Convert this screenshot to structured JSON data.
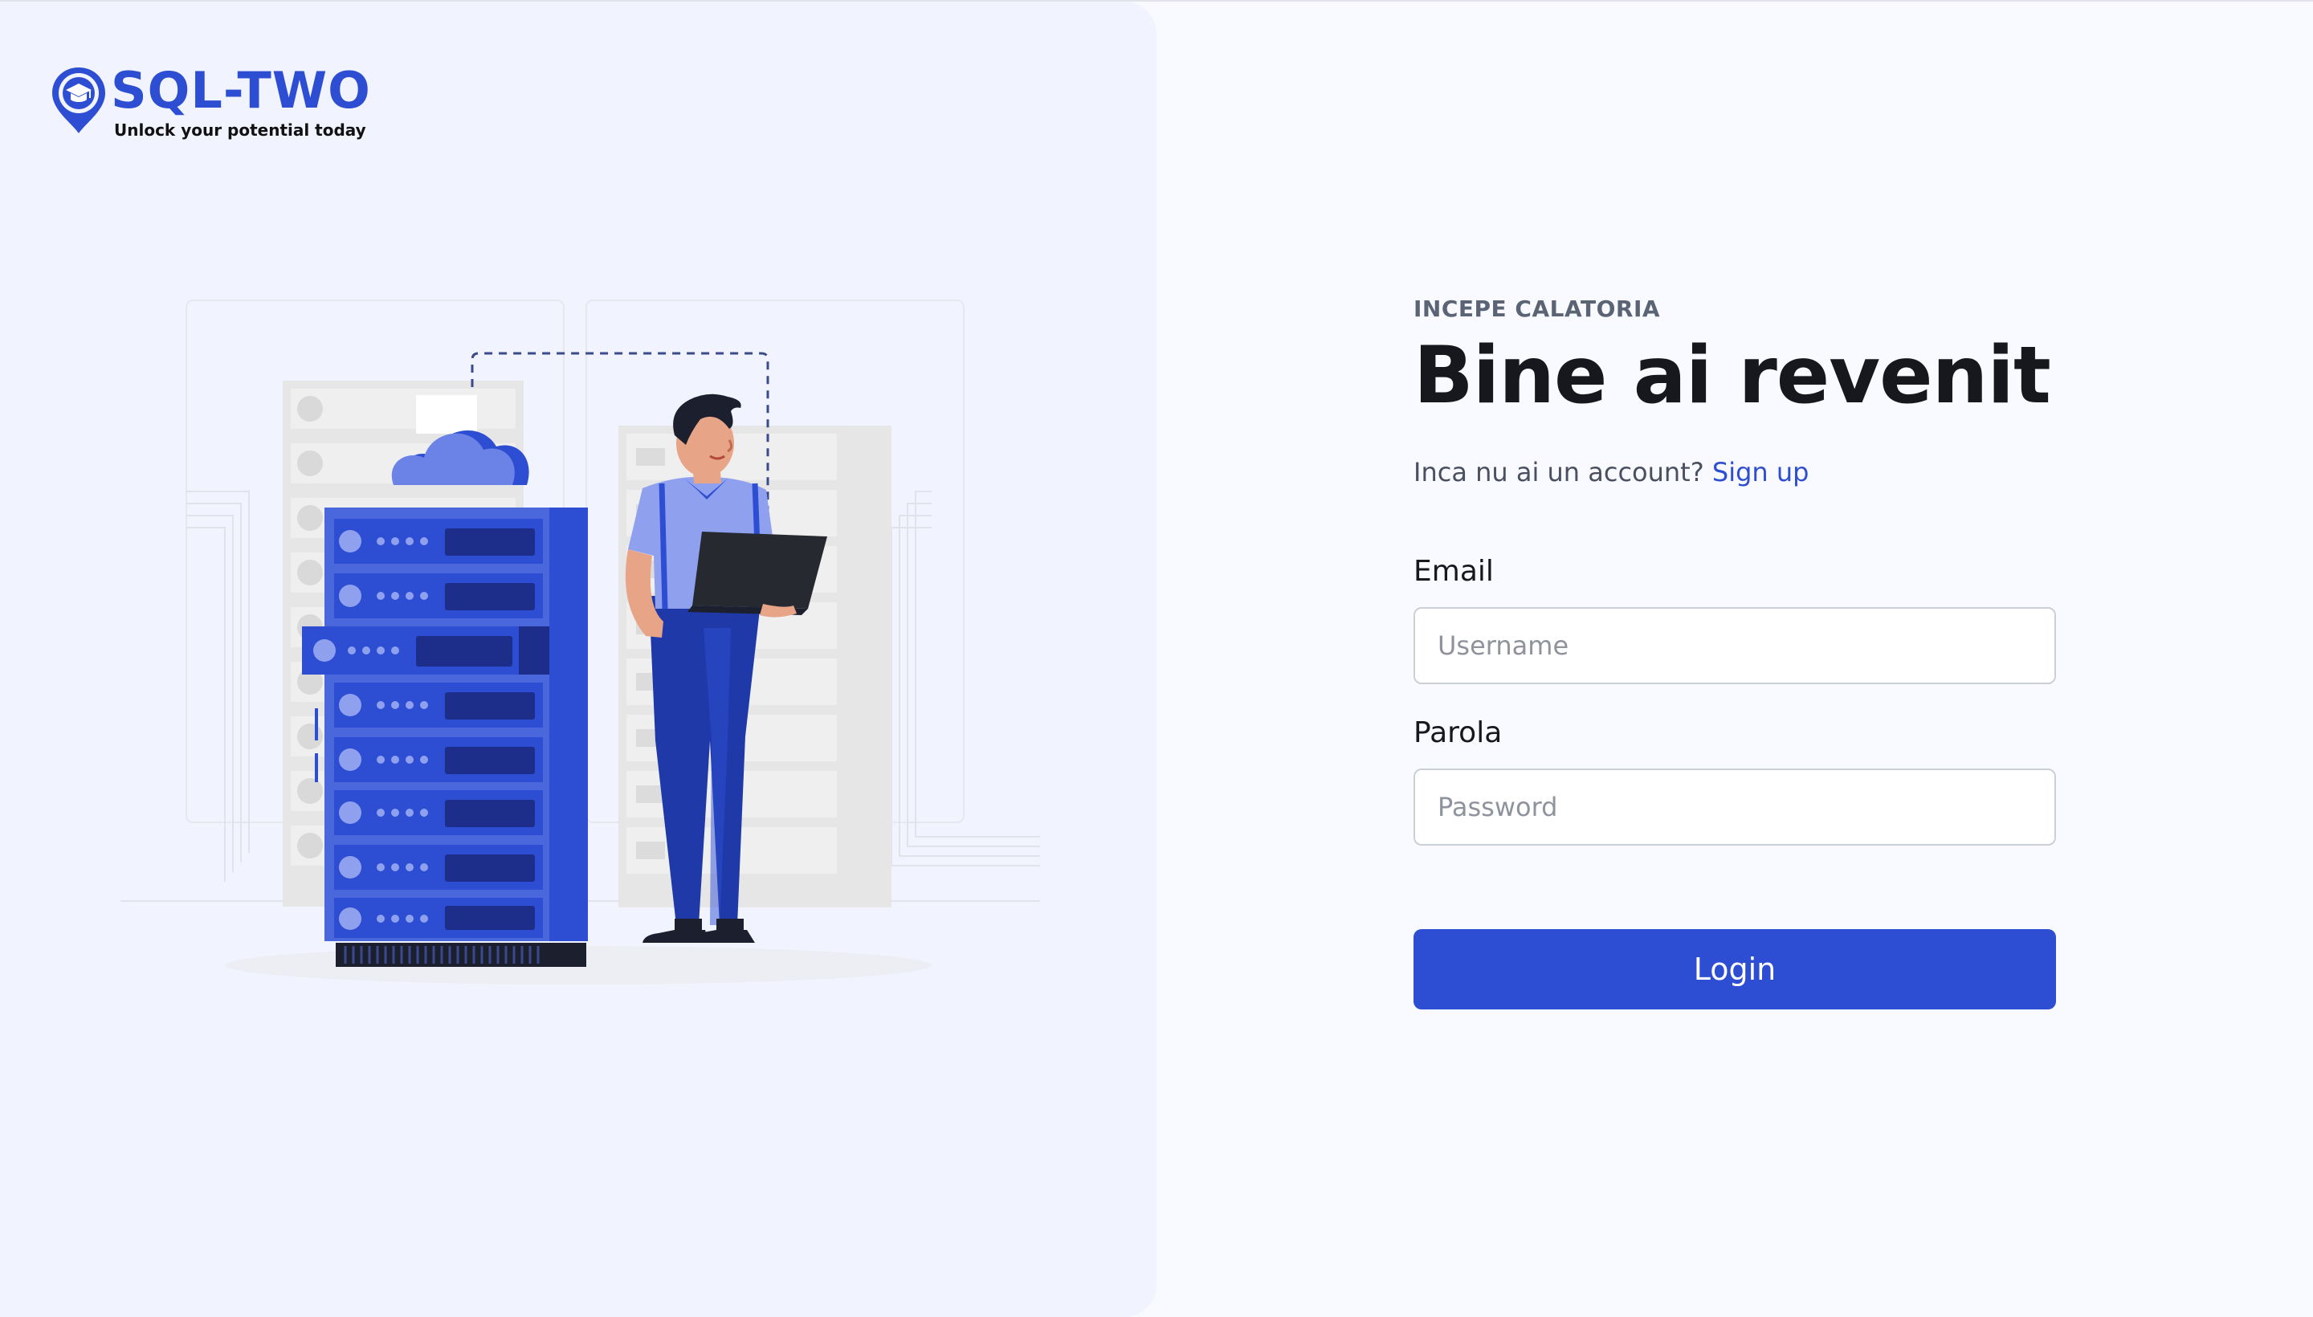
{
  "brand": {
    "name": "SQL-TWO",
    "tagline": "Unlock your potential today",
    "color": "#2d4ed2"
  },
  "illustration": {
    "icon": "server-rack-person-laptop-cloud-illustration"
  },
  "login": {
    "eyebrow": "INCEPE CALATORIA",
    "title": "Bine ai revenit",
    "signup_prompt": "Inca nu ai un account?",
    "signup_link": "Sign up",
    "email_label": "Email",
    "email_placeholder": "Username",
    "email_value": "",
    "password_label": "Parola",
    "password_placeholder": "Password",
    "password_value": "",
    "submit_label": "Login"
  },
  "colors": {
    "accent": "#2d4ed2",
    "left_panel_bg": "#f1f4fe",
    "page_bg": "#f9faff",
    "heading": "#16181d"
  }
}
